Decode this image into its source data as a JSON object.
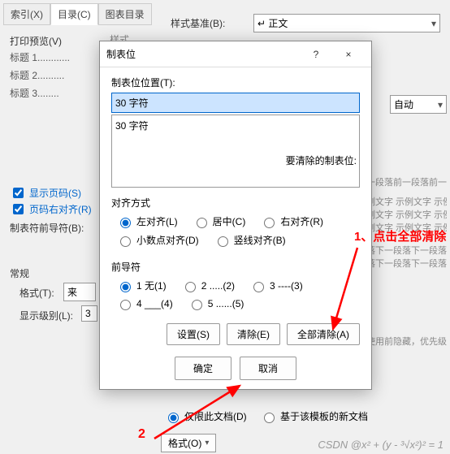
{
  "bg": {
    "tabs": [
      "索引(X)",
      "目录(C)",
      "图表目录"
    ],
    "preview_label": "打印预览(V)",
    "toc_items": [
      "标题 1............",
      "标题 2..........",
      "标题 3........"
    ],
    "style_base_label": "样式基准(B):",
    "style_base_value": "↵ 正文",
    "style_section": "样式",
    "show_pages": "显示页码(S)",
    "right_align": "页码右对齐(R)",
    "leader_label": "制表符前导符(B):",
    "section_general": "常规",
    "format_label": "格式(T):",
    "format_value": "来",
    "level_label": "显示级别(L):",
    "level_value": "3",
    "auto": "自动",
    "sample1": "前一段落前一段落前一段落前一段",
    "sample2": "示例文字 示例文字 示例文字 示",
    "sample3": "示例文字 示例文字 示例文字 示例",
    "sample4": "段落下一段落下一段落下一段落",
    "hint": "，使用前隐藏，优先级",
    "doc_only": "仅限此文档(D)",
    "template_based": "基于该模板的新文档",
    "format_btn": "格式(O)"
  },
  "dialog": {
    "title": "制表位",
    "help": "?",
    "close": "×",
    "pos_label": "制表位位置(T):",
    "pos_value": "30 字符",
    "list_item": "30 字符",
    "clear_label": "要清除的制表位:",
    "align_title": "对齐方式",
    "align_left": "左对齐(L)",
    "align_center": "居中(C)",
    "align_right": "右对齐(R)",
    "align_decimal": "小数点对齐(D)",
    "align_bar": "竖线对齐(B)",
    "leader_title": "前导符",
    "leader_1": "1 无(1)",
    "leader_2": "2 .....(2)",
    "leader_3": "3 ----(3)",
    "leader_4": "4 ___(4)",
    "leader_5": "5 ......(5)",
    "btn_set": "设置(S)",
    "btn_clear": "清除(E)",
    "btn_clear_all": "全部清除(A)",
    "btn_ok": "确定",
    "btn_cancel": "取消"
  },
  "annotations": {
    "a1": "1、点击全部清除",
    "a2": "2",
    "watermark": "CSDN @x² + (y - ³√x²)² = 1"
  }
}
